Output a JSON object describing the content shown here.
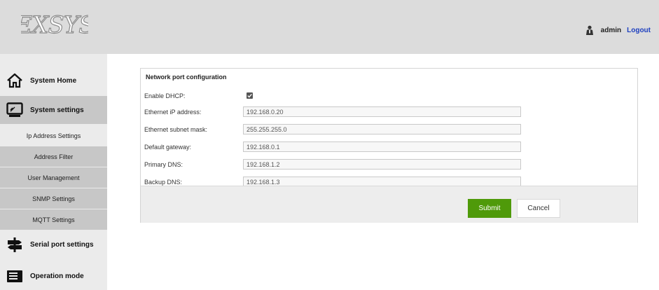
{
  "header": {
    "logo_text": "EXSYS",
    "user_name": "admin",
    "logout_label": "Logout"
  },
  "sidebar": {
    "system_home": "System Home",
    "system_settings": "System settings",
    "sub_items": [
      {
        "label": "Ip Address Settings",
        "active": true
      },
      {
        "label": "Address Filter",
        "active": false
      },
      {
        "label": "User Management",
        "active": false
      },
      {
        "label": "SNMP Settings",
        "active": false
      },
      {
        "label": "MQTT Settings",
        "active": false
      }
    ],
    "serial_port_settings": "Serial port settings",
    "operation_mode": "Operation mode"
  },
  "form": {
    "title": "Network port configuration",
    "dhcp_label": "Enable DHCP:",
    "dhcp_checked": true,
    "fields": [
      {
        "label": "Ethernet iP address:",
        "value": "192.168.0.20"
      },
      {
        "label": "Ethernet subnet mask:",
        "value": "255.255.255.0"
      },
      {
        "label": "Default gateway:",
        "value": "192.168.0.1"
      },
      {
        "label": "Primary DNS:",
        "value": "192.168.1.2"
      },
      {
        "label": "Backup DNS:",
        "value": "192.168.1.3"
      }
    ],
    "submit_label": "Submit",
    "cancel_label": "Cancel"
  },
  "colors": {
    "submit_green": "#4f9a0a",
    "logout_blue": "#1d3fbf",
    "header_gray": "#dcdcdc",
    "sidebar_active": "#c7c7c7"
  }
}
